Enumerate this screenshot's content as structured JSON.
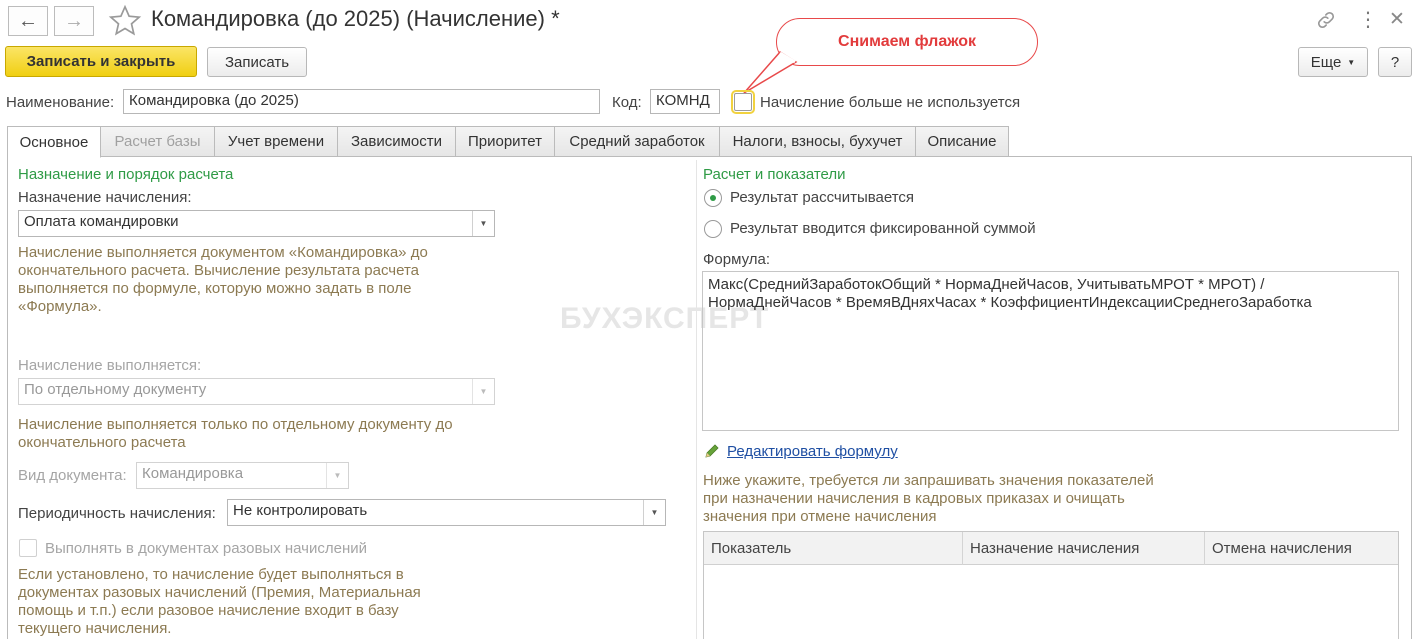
{
  "window": {
    "title": "Командировка (до 2025) (Начисление) *",
    "icons": {
      "back": "arrow-left-icon",
      "forward": "arrow-right-icon",
      "favorite": "star-icon",
      "link": "link-icon",
      "menu": "more-vert-icon",
      "close": "close-icon"
    }
  },
  "toolbar": {
    "save_close_label": "Записать и закрыть",
    "save_label": "Записать",
    "more_label": "Еще",
    "help_label": "?"
  },
  "callout": {
    "text": "Снимаем флажок",
    "color": "#e23b3c"
  },
  "header": {
    "name_label": "Наименование:",
    "name_value": "Командировка (до 2025)",
    "code_label": "Код:",
    "code_value": "КОМНД",
    "not_used_label": "Начисление больше не используется",
    "not_used_checked": false
  },
  "tabs": [
    {
      "label": "Основное",
      "active": true,
      "enabled": true
    },
    {
      "label": "Расчет базы",
      "active": false,
      "enabled": false
    },
    {
      "label": "Учет времени",
      "active": false,
      "enabled": true
    },
    {
      "label": "Зависимости",
      "active": false,
      "enabled": true
    },
    {
      "label": "Приоритет",
      "active": false,
      "enabled": true
    },
    {
      "label": "Средний заработок",
      "active": false,
      "enabled": true
    },
    {
      "label": "Налоги, взносы, бухучет",
      "active": false,
      "enabled": true
    },
    {
      "label": "Описание",
      "active": false,
      "enabled": true
    }
  ],
  "left": {
    "section_title": "Назначение и порядок расчета",
    "purpose_label": "Назначение начисления:",
    "purpose_value": "Оплата командировки",
    "purpose_note_1": "Начисление выполняется документом «Командировка» до",
    "purpose_note_2": "окончательного расчета. Вычисление результата расчета",
    "purpose_note_3": "выполняется по формуле, которую можно задать в поле",
    "purpose_note_4": "«Формула».",
    "performed_label": "Начисление выполняется:",
    "performed_value": "По отдельному документу",
    "performed_note_1": "Начисление выполняется только по отдельному документу до",
    "performed_note_2": "окончательного расчета",
    "doc_type_label": "Вид документа:",
    "doc_type_value": "Командировка",
    "periodicity_label": "Периодичность начисления:",
    "periodicity_value": "Не контролировать",
    "one_time_label": "Выполнять в документах разовых начислений",
    "one_time_note_1": "Если установлено, то начисление будет выполняться в",
    "one_time_note_2": "документах разовых начислений (Премия, Материальная",
    "one_time_note_3": "помощь и т.п.) если разовое начисление входит в базу",
    "one_time_note_4": "текущего начисления."
  },
  "right": {
    "section_title": "Расчет и показатели",
    "radio_calculated": "Результат рассчитывается",
    "radio_fixed": "Результат вводится фиксированной суммой",
    "selected": "calculated",
    "formula_label": "Формула:",
    "formula_line_1": "Макс(СреднийЗаработокОбщий * НормаДнейЧасов, УчитыватьМРОТ * МРОТ) /",
    "formula_line_2": "НормаДнейЧасов * ВремяВДняхЧасах * КоэффициентИндексацииСреднегоЗаработка",
    "edit_formula_link": "Редактировать формулу",
    "edit_icon": "pencil-icon",
    "indicators_note_1": "Ниже укажите, требуется ли запрашивать значения показателей",
    "indicators_note_2": "при назначении начисления в кадровых приказах и очищать",
    "indicators_note_3": "значения при отмене начисления",
    "table_columns": [
      "Показатель",
      "Назначение начисления",
      "Отмена начисления"
    ]
  },
  "watermark": "БУХЭКСПЕРТ"
}
